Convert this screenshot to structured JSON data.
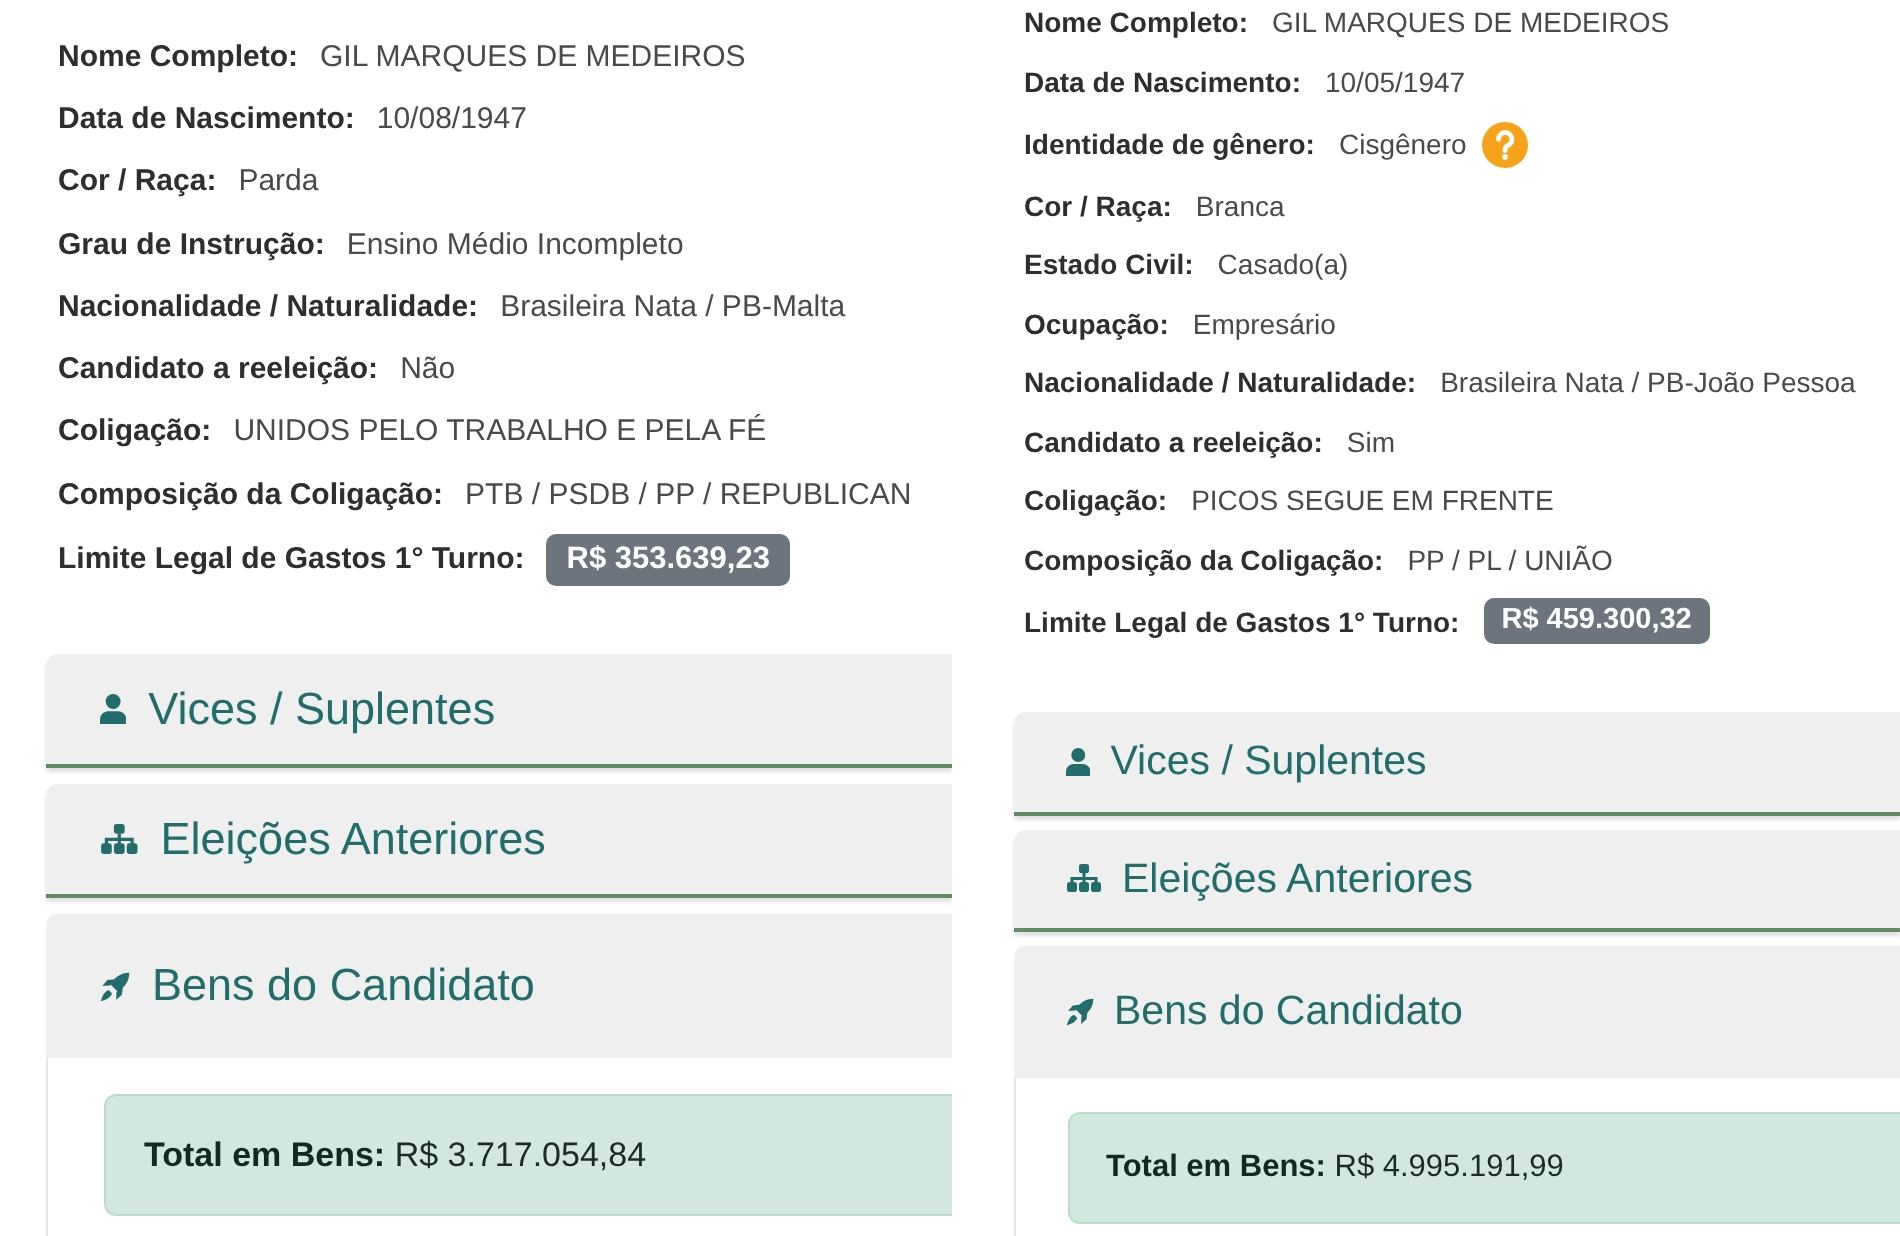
{
  "panels": [
    {
      "fields": [
        {
          "label": "Nome Completo:",
          "value": "GIL MARQUES DE MEDEIROS",
          "help": false
        },
        {
          "label": "Data de Nascimento:",
          "value": "10/08/1947",
          "help": false
        },
        {
          "label": "Cor / Raça:",
          "value": "Parda",
          "help": false
        },
        {
          "label": "Grau de Instrução:",
          "value": "Ensino Médio Incompleto",
          "help": false
        },
        {
          "label": "Nacionalidade / Naturalidade:",
          "value": "Brasileira Nata / PB-Malta",
          "help": false
        },
        {
          "label": "Candidato a reeleição:",
          "value": "Não",
          "help": false
        },
        {
          "label": "Coligação:",
          "value": "UNIDOS PELO TRABALHO E PELA FÉ",
          "help": false
        },
        {
          "label": "Composição da Coligação:",
          "value": "PTB / PSDB / PP / REPUBLICAN",
          "help": false
        }
      ],
      "spending_limit": {
        "label": "Limite Legal de Gastos 1° Turno:",
        "value": "R$ 353.639,23"
      },
      "sections": [
        {
          "kind": "deputies",
          "title": "Vices / Suplentes",
          "expanded": false
        },
        {
          "kind": "elections",
          "title": "Eleições Anteriores",
          "expanded": false
        },
        {
          "kind": "assets",
          "title": "Bens do Candidato",
          "expanded": true,
          "total": "**Total em Bens:** R$ 3.717.054,84"
        }
      ]
    },
    {
      "fields": [
        {
          "label": "Nome Completo:",
          "value": "GIL MARQUES DE MEDEIROS",
          "help": false
        },
        {
          "label": "Data de Nascimento:",
          "value": "10/05/1947",
          "help": false
        },
        {
          "label": "Identidade de gênero:",
          "value": "Cisgênero",
          "help": true
        },
        {
          "label": "Cor / Raça:",
          "value": "Branca",
          "help": false
        },
        {
          "label": "Estado Civil:",
          "value": "Casado(a)",
          "help": false
        },
        {
          "label": "Ocupação:",
          "value": "Empresário",
          "help": false
        },
        {
          "label": "Nacionalidade / Naturalidade:",
          "value": "Brasileira Nata / PB-João Pessoa",
          "help": false
        },
        {
          "label": "Candidato a reeleição:",
          "value": "Sim",
          "help": false
        },
        {
          "label": "Coligação:",
          "value": "PICOS SEGUE EM FRENTE",
          "help": false
        },
        {
          "label": "Composição da Coligação:",
          "value": "PP / PL / UNIÃO",
          "help": false
        }
      ],
      "spending_limit": {
        "label": "Limite Legal de Gastos 1° Turno:",
        "value": "R$ 459.300,32"
      },
      "sections": [
        {
          "kind": "deputies",
          "title": "Vices / Suplentes",
          "expanded": false
        },
        {
          "kind": "elections",
          "title": "Eleições Anteriores",
          "expanded": false
        },
        {
          "kind": "assets",
          "title": "Bens do Candidato",
          "expanded": true,
          "total": "**Total em Bens:** R$ 4.995.191,99"
        }
      ]
    }
  ]
}
